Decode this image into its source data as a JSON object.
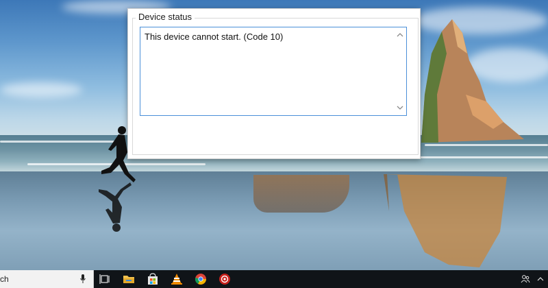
{
  "dialog": {
    "group_label": "Device status",
    "status_text": "This device cannot start. (Code 10)"
  },
  "taskbar": {
    "search_partial": "ch",
    "icons": [
      "microphone-icon",
      "task-view-icon",
      "file-explorer-icon",
      "store-icon",
      "vlc-icon",
      "chrome-icon",
      "app-icon"
    ],
    "tray_icons": [
      "people-icon",
      "chevron-up-icon"
    ]
  },
  "colors": {
    "accent_border": "#4a8fd8",
    "taskbar_bg": "#101418"
  }
}
